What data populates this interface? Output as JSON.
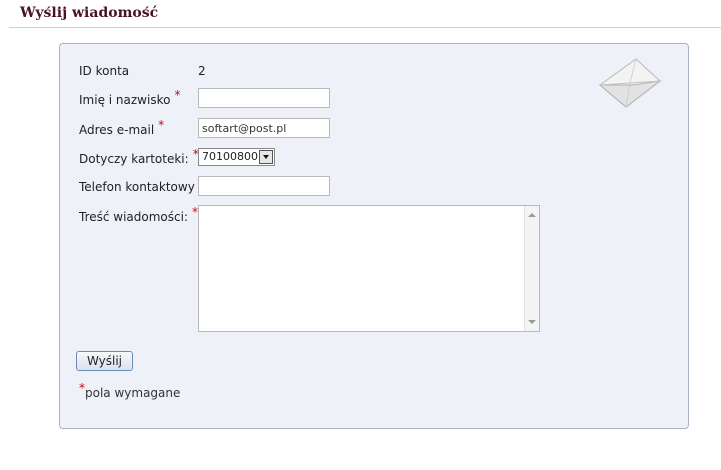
{
  "header": {
    "title": "Wyślij wiadomość"
  },
  "form": {
    "account_id_label": "ID konta",
    "account_id_value": "2",
    "name_label": "Imię i nazwisko",
    "name_value": "",
    "email_label": "Adres e-mail",
    "email_value": "softart@post.pl",
    "card_label": "Dotyczy kartoteki:",
    "card_selected": "70100800",
    "phone_label": "Telefon kontaktowy",
    "phone_value": "",
    "message_label": "Treść wiadomości:",
    "message_value": "",
    "required_marker": "*",
    "submit_label": "Wyślij",
    "required_note": "pola wymagane"
  },
  "colors": {
    "title": "#4a1224",
    "required_star": "#d4001a",
    "panel_bg": "#eef1f8",
    "panel_border": "#a9b2c2"
  },
  "icons": {
    "decoration": "envelope-icon"
  }
}
